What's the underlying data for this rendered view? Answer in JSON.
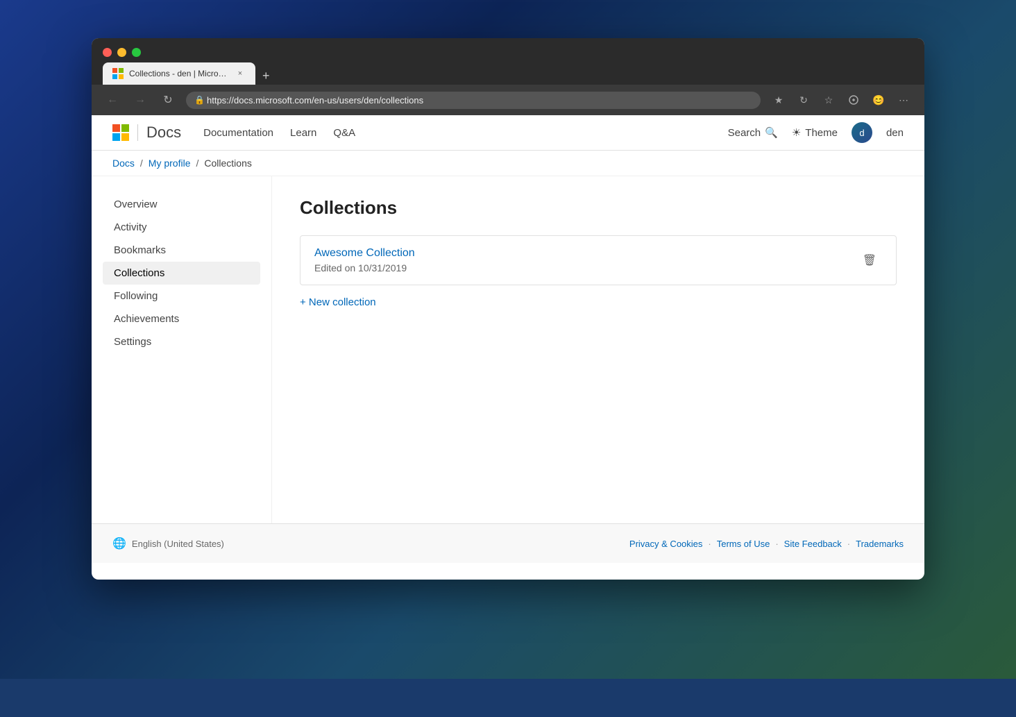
{
  "browser": {
    "tab": {
      "title": "Collections - den | Microsoft Do",
      "url": "https://docs.microsoft.com/en-us/users/den/collections",
      "close_label": "×",
      "new_tab_label": "+"
    },
    "nav": {
      "back_label": "←",
      "forward_label": "→",
      "refresh_label": "↻"
    },
    "toolbar_icons": [
      "★",
      "↻",
      "☆",
      "👤",
      "😊",
      "⋯"
    ]
  },
  "site": {
    "logo_text": "Microsoft",
    "brand": "Docs",
    "nav_items": [
      {
        "label": "Documentation"
      },
      {
        "label": "Learn"
      },
      {
        "label": "Q&A"
      }
    ],
    "search_label": "Search",
    "theme_label": "Theme",
    "user_name": "den",
    "user_initial": "d"
  },
  "breadcrumb": {
    "items": [
      {
        "label": "Docs",
        "href": "#"
      },
      {
        "label": "My profile",
        "href": "#"
      },
      {
        "label": "Collections"
      }
    ]
  },
  "sidebar": {
    "items": [
      {
        "label": "Overview",
        "active": false
      },
      {
        "label": "Activity",
        "active": false
      },
      {
        "label": "Bookmarks",
        "active": false
      },
      {
        "label": "Collections",
        "active": true
      },
      {
        "label": "Following",
        "active": false
      },
      {
        "label": "Achievements",
        "active": false
      },
      {
        "label": "Settings",
        "active": false
      }
    ]
  },
  "main": {
    "page_title": "Collections",
    "collection": {
      "name": "Awesome Collection",
      "date": "Edited on 10/31/2019",
      "delete_label": "🗑"
    },
    "new_collection_label": "+ New collection"
  },
  "footer": {
    "locale": "English (United States)",
    "links": [
      {
        "label": "Privacy & Cookies"
      },
      {
        "label": "Terms of Use"
      },
      {
        "label": "Site Feedback"
      },
      {
        "label": "Trademarks"
      }
    ]
  }
}
